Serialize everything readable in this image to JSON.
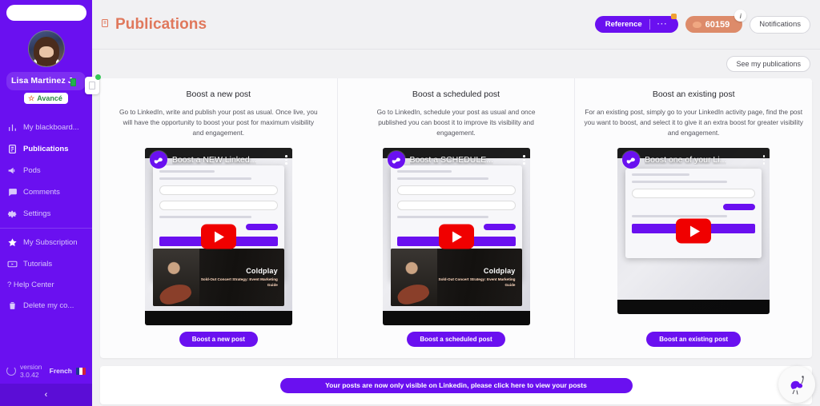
{
  "sidebar": {
    "logo_alt": "logo-placeholder",
    "user": {
      "name": "Lisa  Martinez J.",
      "rank_label": "Avancé",
      "rank_star": "☆"
    },
    "items": [
      {
        "label": "My blackboard...",
        "icon": "chart-bar-icon",
        "active": false
      },
      {
        "label": "Publications",
        "icon": "document-icon",
        "active": true
      },
      {
        "label": "Pods",
        "icon": "megaphone-icon",
        "active": false
      },
      {
        "label": "Comments",
        "icon": "comment-icon",
        "active": false
      },
      {
        "label": "Settings",
        "icon": "gear-icon",
        "active": false
      },
      {
        "label": "My Subscription",
        "icon": "star-icon",
        "active": false
      },
      {
        "label": "Tutorials",
        "icon": "video-icon",
        "active": false
      },
      {
        "label": "? Help Center",
        "icon": "question-icon",
        "active": false
      },
      {
        "label": "Delete my co...",
        "icon": "trash-icon",
        "active": false
      }
    ],
    "footer": {
      "version_label": "version",
      "version_number": "3.0.42",
      "language": "French"
    },
    "collapse_glyph": "‹"
  },
  "header": {
    "title": "Publications",
    "title_icon": "document-icon",
    "title_color": "#e0785c",
    "reference_button": {
      "label": "Reference",
      "dots": "···"
    },
    "credits": {
      "value": "60159",
      "icon": "coin-icon",
      "info_glyph": "i"
    },
    "notifications_button": "Notifications",
    "see_publications_button": "See my publications"
  },
  "cards": [
    {
      "title": "Boost a new post",
      "description": "Go to LinkedIn, write and publish your post as usual. Once live, you will have the opportunity to boost your post for maximum visibility and engagement.",
      "video": {
        "title": "Boost a NEW Linked...",
        "thumb_title": "Coldplay",
        "thumb_subtitle": "Sold-Out Concert Strategy:\nEvent Marketing Guide"
      },
      "cta": "Boost a new post"
    },
    {
      "title": "Boost a scheduled post",
      "description": "Go to LinkedIn, schedule your post as usual and once published you can boost it to improve its visibility and engagement.",
      "video": {
        "title": "Boost a SCHEDULE...",
        "thumb_title": "Coldplay",
        "thumb_subtitle": "Sold-Out Concert Strategy:\nEvent Marketing Guide"
      },
      "cta": "Boost a scheduled post"
    },
    {
      "title": "Boost an existing post",
      "description": "For an existing post, simply go to your LinkedIn activity page, find the post you want to boost, and select it to give it an extra boost for greater visibility and engagement.",
      "video": {
        "title": "Boost one of your Li...",
        "thumb_title": "",
        "thumb_subtitle": ""
      },
      "cta": "Boost an existing post"
    }
  ],
  "bottom": {
    "banner": "Your posts are now only visible on Linkedin, please click here to view your posts"
  },
  "colors": {
    "brand_purple": "#6a10f0",
    "title_coral": "#e0785c",
    "credits_orange": "#dd8b6a"
  }
}
